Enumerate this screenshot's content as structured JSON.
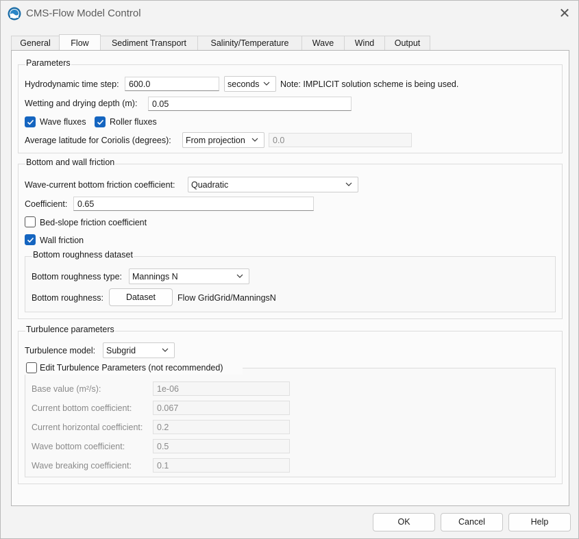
{
  "window": {
    "title": "CMS-Flow Model Control",
    "close_glyph": "✕"
  },
  "tabs": [
    {
      "label": "General"
    },
    {
      "label": "Flow"
    },
    {
      "label": "Sediment Transport"
    },
    {
      "label": "Salinity/Temperature"
    },
    {
      "label": "Wave"
    },
    {
      "label": "Wind"
    },
    {
      "label": "Output"
    }
  ],
  "active_tab": "Flow",
  "parameters": {
    "title": "Parameters",
    "time_step_label": "Hydrodynamic time step:",
    "time_step_value": "600.0",
    "time_unit": "seconds",
    "note": "Note: IMPLICIT solution scheme is being used.",
    "wetting_label": "Wetting and drying depth (m):",
    "wetting_value": "0.05",
    "wave_fluxes_label": "Wave fluxes",
    "wave_fluxes_checked": true,
    "roller_fluxes_label": "Roller fluxes",
    "roller_fluxes_checked": true,
    "latitude_label": "Average latitude for Coriolis (degrees):",
    "latitude_source": "From projection",
    "latitude_value": "0.0"
  },
  "friction": {
    "title": "Bottom and wall friction",
    "coef_type_label": "Wave-current bottom friction coefficient:",
    "coef_type_value": "Quadratic",
    "coefficient_label": "Coefficient:",
    "coefficient_value": "0.65",
    "bed_slope_label": "Bed-slope friction coefficient",
    "bed_slope_checked": false,
    "wall_friction_label": "Wall friction",
    "wall_friction_checked": true,
    "roughness": {
      "title": "Bottom roughness dataset",
      "type_label": "Bottom roughness type:",
      "type_value": "Mannings N",
      "roughness_label": "Bottom roughness:",
      "dataset_button": "Dataset",
      "dataset_path": "Flow GridGrid/ManningsN"
    }
  },
  "turbulence": {
    "title": "Turbulence parameters",
    "model_label": "Turbulence model:",
    "model_value": "Subgrid",
    "edit_label": "Edit Turbulence Parameters (not recommended)",
    "edit_checked": false,
    "params": [
      {
        "label": "Base value (m²/s):",
        "value": "1e-06"
      },
      {
        "label": "Current bottom coefficient:",
        "value": "0.067"
      },
      {
        "label": "Current horizontal coefficient:",
        "value": "0.2"
      },
      {
        "label": "Wave bottom coefficient:",
        "value": "0.5"
      },
      {
        "label": "Wave breaking coefficient:",
        "value": "0.1"
      }
    ]
  },
  "footer": {
    "ok": "OK",
    "cancel": "Cancel",
    "help": "Help"
  },
  "colors": {
    "accent": "#1565c0",
    "window_bg": "#f3f3f3",
    "panel_bg": "#fbfbfb"
  }
}
